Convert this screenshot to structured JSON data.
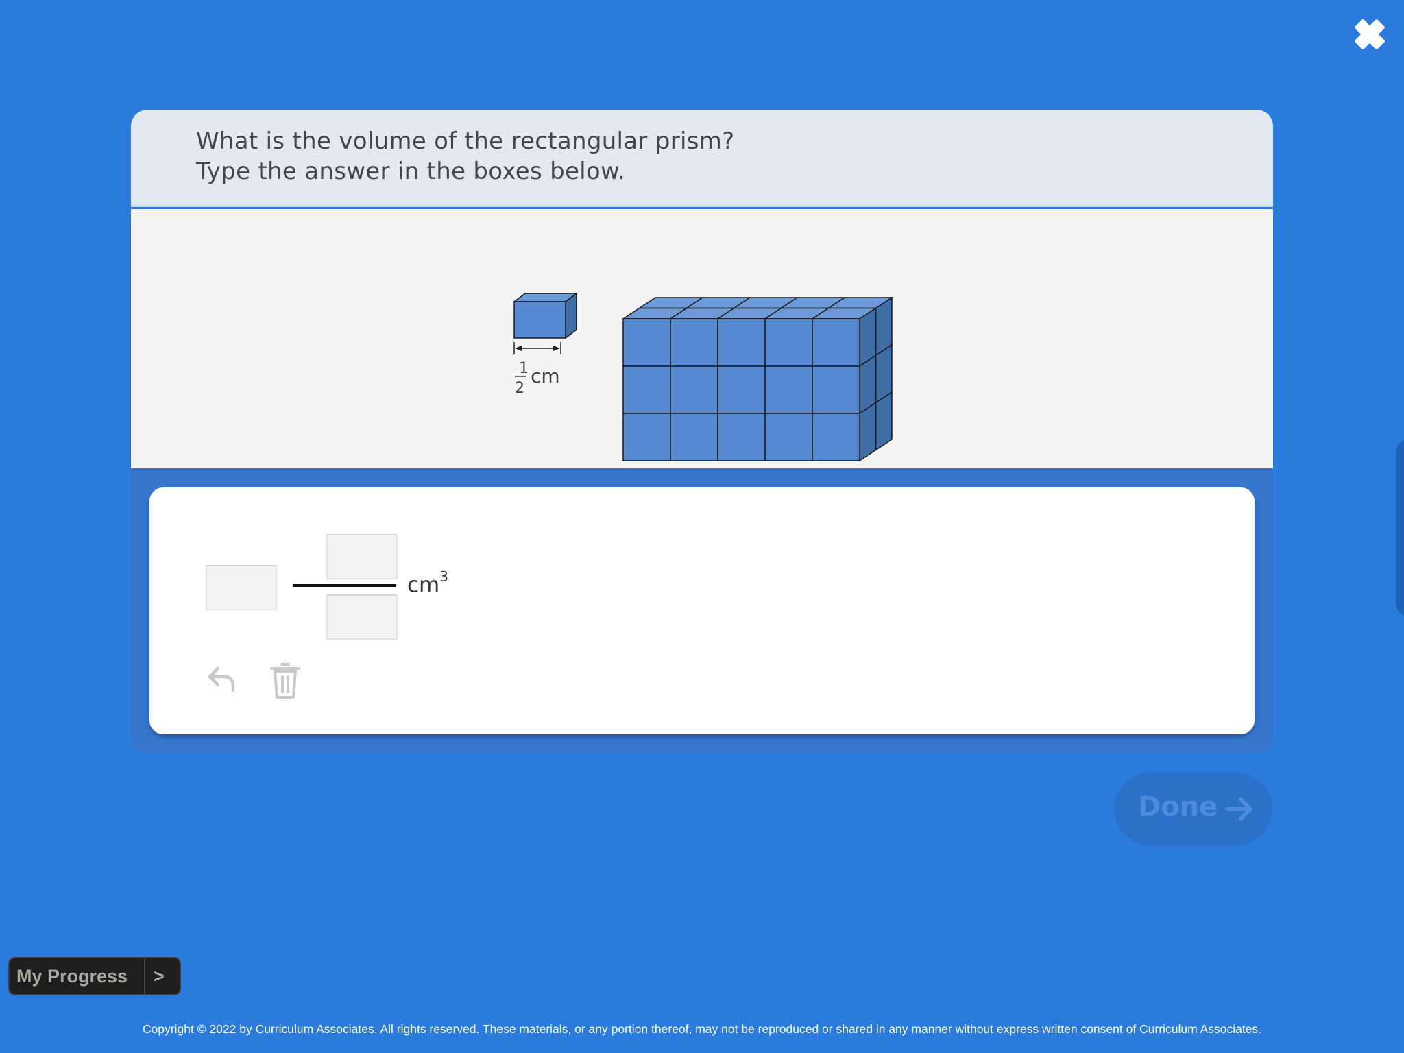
{
  "close": {
    "icon": "close-icon",
    "color": "#ffffff"
  },
  "question": {
    "line1": "What is the volume of the rectangular prism?",
    "line2": "Type the answer in the boxes below."
  },
  "figure": {
    "unit_cube": {
      "edge_numerator": "1",
      "edge_denominator": "2",
      "edge_unit": "cm"
    },
    "prism": {
      "length_cubes": 5,
      "height_cubes": 3,
      "depth_cubes": 2
    },
    "cube_color": "#558ad2"
  },
  "answer": {
    "whole": "",
    "numerator": "",
    "denominator": "",
    "unit_base": "cm",
    "unit_exponent": "3"
  },
  "tools": {
    "undo_icon": "undo-icon",
    "trash_icon": "trash-icon"
  },
  "done": {
    "label": "Done",
    "icon": "arrow-right-icon"
  },
  "progress": {
    "label": "My Progress",
    "chevron": ">"
  },
  "footer": {
    "copyright": "Copyright © 2022 by Curriculum Associates. All rights reserved. These materials, or any portion thereof, may not be reproduced or shared in any manner without express written consent of Curriculum Associates."
  },
  "colors": {
    "background": "#2a7bdc",
    "accent": "#3575cb"
  }
}
